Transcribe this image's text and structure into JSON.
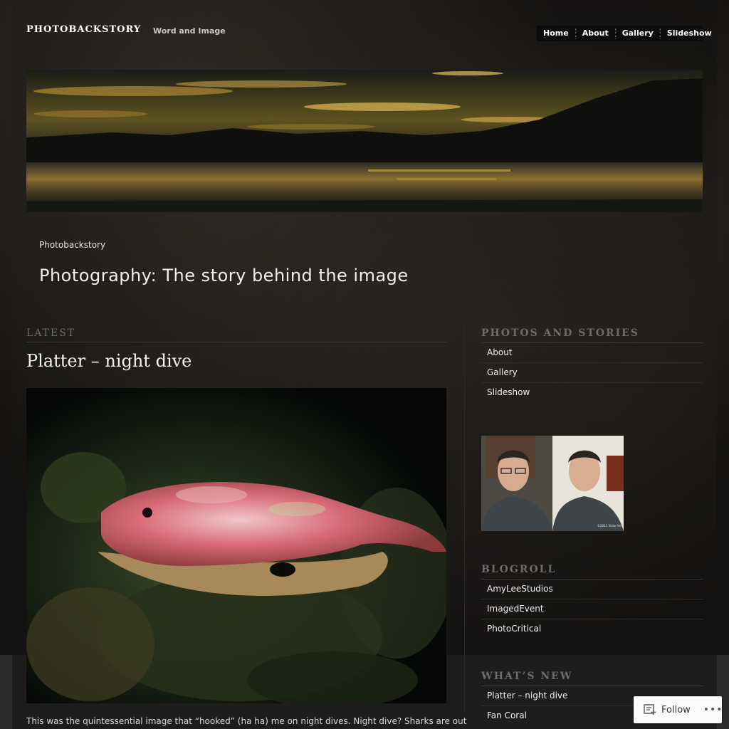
{
  "site": {
    "title": "PHOTOBACKSTORY",
    "description": "Word and Image"
  },
  "topnav": [
    "Home",
    "About",
    "Gallery",
    "Slideshow"
  ],
  "header": {
    "breadcrumb": "Photobackstory",
    "tagline": "Photography: The story behind the image"
  },
  "latest": {
    "label": "LATEST",
    "post_title": "Platter – night dive",
    "excerpt": "This was the quintessential image that “hooked” (ha ha) me on night dives. Night dive? Sharks are out"
  },
  "sidebar": {
    "photos_title": "PHOTOS AND STORIES",
    "photos_items": [
      "About",
      "Gallery",
      "Slideshow"
    ],
    "portrait_caption": "©2011 Victor Ho",
    "blogroll_title": "BLOGROLL",
    "blogroll_items": [
      "AmyLeeStudios",
      "ImagedEvent",
      "PhotoCritical"
    ],
    "whatsnew_title": "WHAT’S NEW",
    "whatsnew_items": [
      "Platter – night dive",
      "Fan Coral"
    ]
  },
  "follow": {
    "label": "Follow",
    "more": "•••"
  },
  "icons": {
    "follow": "reader-follow-icon",
    "more": "more-dots-icon"
  },
  "colors": {
    "background": "#141210",
    "nav_bg": "#0c0c0c",
    "widget_title": "#6c6c6c",
    "text": "#f0f0f0"
  }
}
